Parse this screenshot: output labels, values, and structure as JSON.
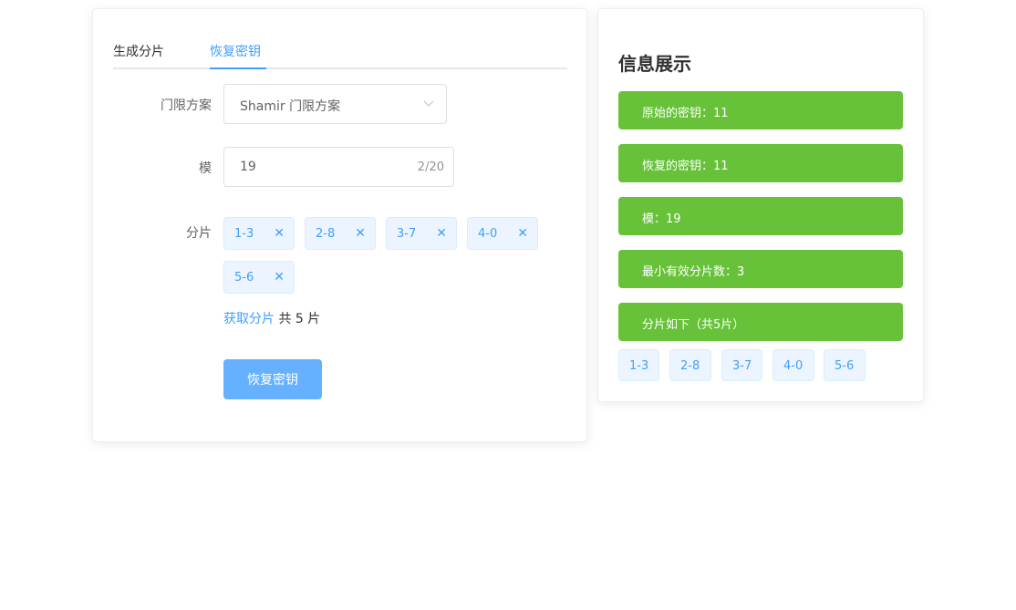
{
  "tabs": [
    {
      "label": "生成分片"
    },
    {
      "label": "恢复密钥"
    }
  ],
  "form": {
    "scheme_label": "门限方案",
    "scheme_value": "Shamir 门限方案",
    "modulus_label": "模",
    "modulus_value": "19",
    "modulus_count": "2/20",
    "shares_label": "分片",
    "shares": [
      "1-3",
      "2-8",
      "3-7",
      "4-0",
      "5-6"
    ],
    "get_shares_link": "获取分片",
    "share_total_text": "共 5 片",
    "recover_button": "恢复密钥"
  },
  "info": {
    "title": "信息展示",
    "bars": [
      {
        "text": "原始的密钥：11"
      },
      {
        "text": "恢复的密钥：11"
      },
      {
        "text": "模：19"
      },
      {
        "text": "最小有效分片数：3"
      },
      {
        "text": "分片如下（共5片）"
      }
    ],
    "shares": [
      "1-3",
      "2-8",
      "3-7",
      "4-0",
      "5-6"
    ]
  },
  "colors": {
    "primary": "#409eff",
    "success": "#67c23a",
    "button_light": "#66b1ff"
  }
}
